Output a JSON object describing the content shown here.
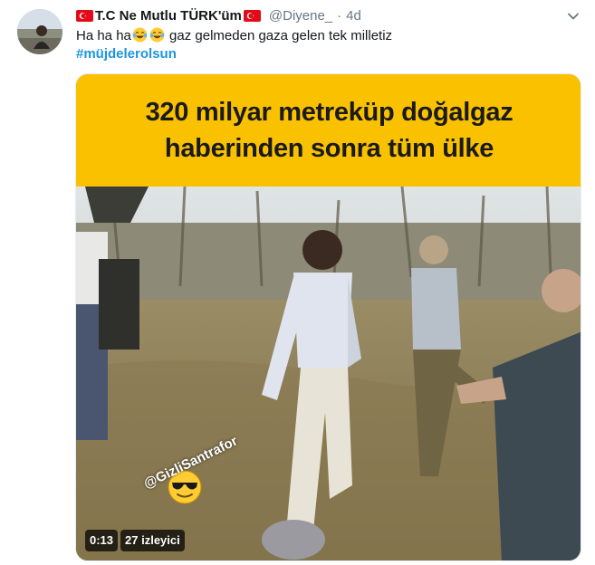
{
  "tweet": {
    "author_name": "T.C Ne Mutlu TÜRK'üm",
    "handle": "@Diyene_",
    "separator": "·",
    "time": "4d",
    "text_before": "Ha ha ha",
    "text_after": " gaz gelmeden gaza gelen tek milletiz",
    "emojis": [
      "face-with-tears-of-joy",
      "face-with-tears-of-joy"
    ],
    "hashtag": "#müjdelerolsun"
  },
  "video": {
    "banner_line_1": "320 milyar metreküp doğalgaz",
    "banner_line_2": "haberinden sonra tüm ülke",
    "watermark": "@GizliSantrafor",
    "duration": "0:13",
    "views": "27 izleyici"
  },
  "colors": {
    "banner": "#f9c100",
    "link": "#1b95e0",
    "secondary_text": "#657786",
    "flag_red": "#e30a17"
  },
  "icons": [
    "avatar",
    "turkish-flag-icon",
    "chevron-down-icon",
    "sunglasses-emoji-icon"
  ]
}
